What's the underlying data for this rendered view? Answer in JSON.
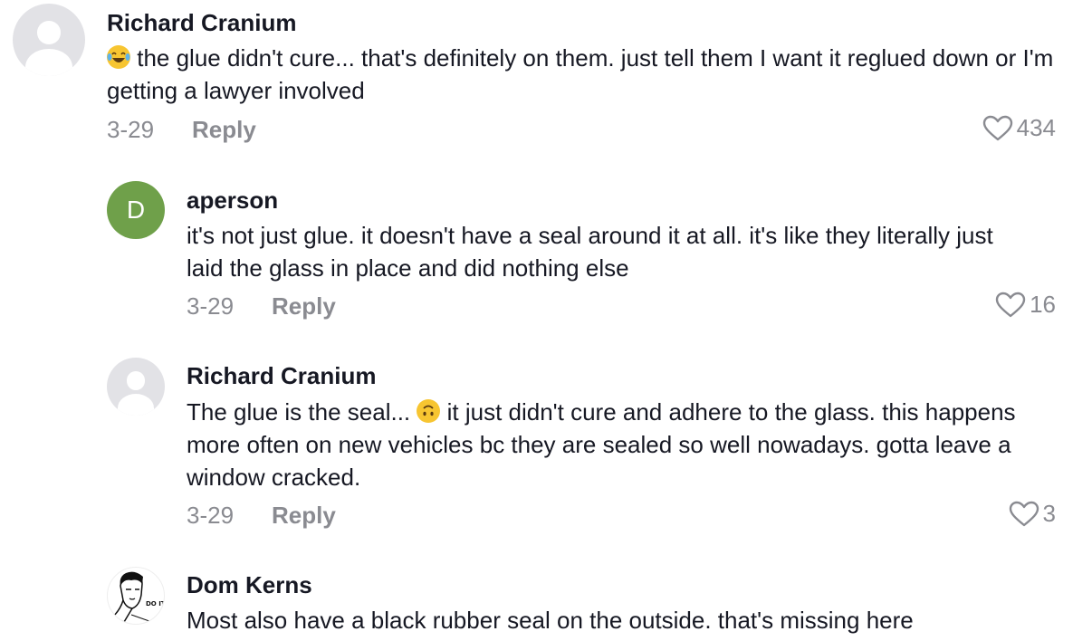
{
  "comments": [
    {
      "username": "Richard Cranium",
      "avatar": "default-avatar",
      "emoji": "laughing-crying-emoji",
      "text": "the glue didn't cure... that's definitely on them. just tell them I want it reglued down or I'm getting a lawyer involved",
      "date": "3-29",
      "reply_label": "Reply",
      "likes": "434"
    },
    {
      "username": "aperson",
      "avatar_letter": "D",
      "avatar_color": "#6fa04a",
      "text": "it's not just glue. it doesn't have a seal around it at all. it's like they literally just laid the glass in place and did nothing else",
      "date": "3-29",
      "reply_label": "Reply",
      "likes": "16"
    },
    {
      "username": "Richard Cranium",
      "avatar": "default-avatar",
      "text_before": "The glue is the seal...",
      "emoji": "upside-down-face-emoji",
      "text_after": "it just didn't cure and adhere to the glass. this happens more often on new vehicles bc they are sealed so well nowadays. gotta leave a window cracked.",
      "date": "3-29",
      "reply_label": "Reply",
      "likes": "3"
    },
    {
      "username": "Dom Kerns",
      "avatar": "sketch-portrait-avatar",
      "avatar_caption": "DO IT.",
      "text": "Most also have a black rubber seal on the outside. that's missing here"
    }
  ],
  "colors": {
    "primary_text": "#161823",
    "secondary_text": "#8a8b91",
    "heart_outline": "#8a8b91"
  }
}
